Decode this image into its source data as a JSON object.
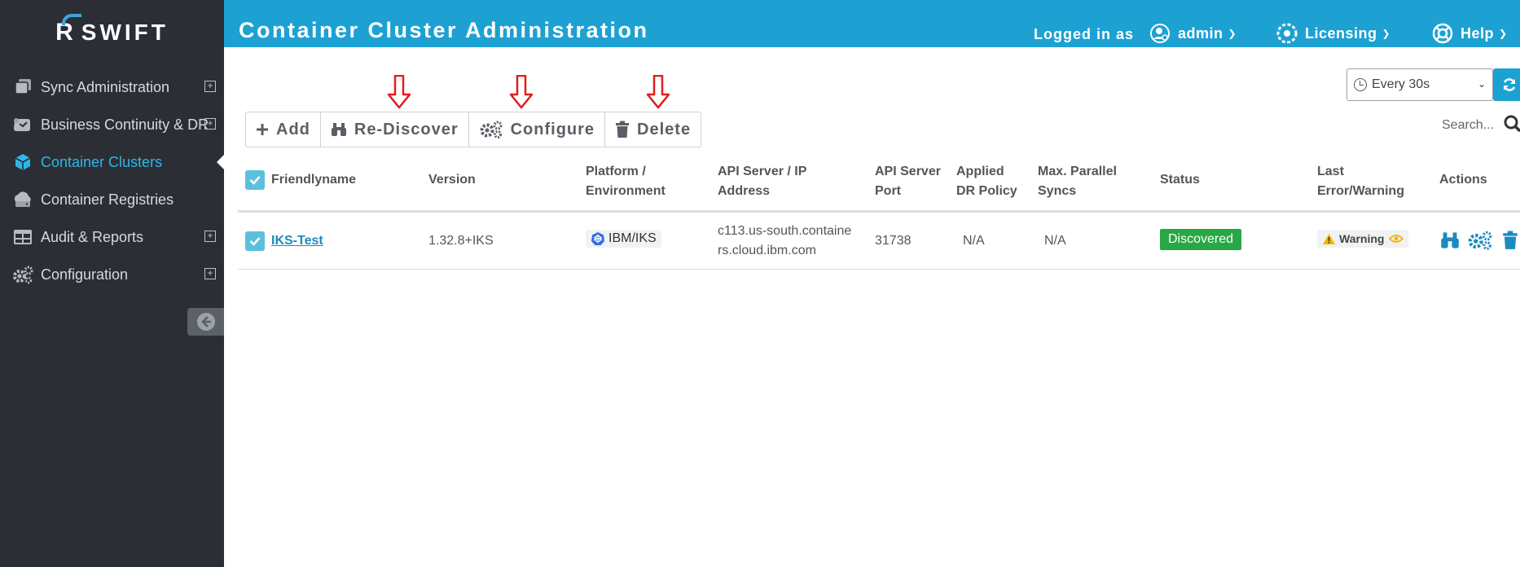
{
  "brand": {
    "name": "SWIFT",
    "mark": "R"
  },
  "sidebar": {
    "items": [
      {
        "label": "Sync Administration",
        "icon": "copy-stack-icon",
        "expandable": true,
        "active": false
      },
      {
        "label": "Business Continuity & DR",
        "icon": "map-scroll-icon",
        "expandable": true,
        "active": false
      },
      {
        "label": "Container Clusters",
        "icon": "cube-icon",
        "expandable": false,
        "active": true
      },
      {
        "label": "Container Registries",
        "icon": "cloud-server-icon",
        "expandable": false,
        "active": false
      },
      {
        "label": "Audit & Reports",
        "icon": "table-icon",
        "expandable": true,
        "active": false
      },
      {
        "label": "Configuration",
        "icon": "gears-icon",
        "expandable": true,
        "active": false
      }
    ],
    "expand_glyph": "+"
  },
  "header": {
    "title": "Container Cluster Administration",
    "logged_in_label": "Logged in as",
    "user": "admin",
    "licensing": "Licensing",
    "help": "Help"
  },
  "refresh": {
    "interval": "Every 30s"
  },
  "toolbar": {
    "add": "Add",
    "rediscover": "Re-Discover",
    "configure": "Configure",
    "delete": "Delete"
  },
  "search": {
    "placeholder": "Search..."
  },
  "table": {
    "headers": {
      "friendlyname": "Friendlyname",
      "version": "Version",
      "platform_l1": "Platform /",
      "platform_l2": "Environment",
      "api_l1": "API Server / IP",
      "api_l2": "Address",
      "port_l1": "API Server",
      "port_l2": "Port",
      "drpolicy_l1": "Applied",
      "drpolicy_l2": "DR Policy",
      "syncs_l1": "Max. Parallel",
      "syncs_l2": "Syncs",
      "status": "Status",
      "lasterr_l1": "Last",
      "lasterr_l2": "Error/Warning",
      "actions": "Actions"
    },
    "rows": [
      {
        "friendlyname": "IKS-Test",
        "version": "1.32.8+IKS",
        "platform": "IBM/IKS",
        "api_l1": "c113.us-south.containe",
        "api_l2": "rs.cloud.ibm.com",
        "port": "31738",
        "dr_policy": "N/A",
        "max_syncs": "N/A",
        "status": "Discovered",
        "last_warning": "Warning"
      }
    ]
  },
  "colors": {
    "header": "#1da1d3",
    "sidebar": "#2b2e35",
    "accent": "#2fb6e8",
    "status_ok": "#28a745",
    "arrow": "#e41b1b"
  }
}
